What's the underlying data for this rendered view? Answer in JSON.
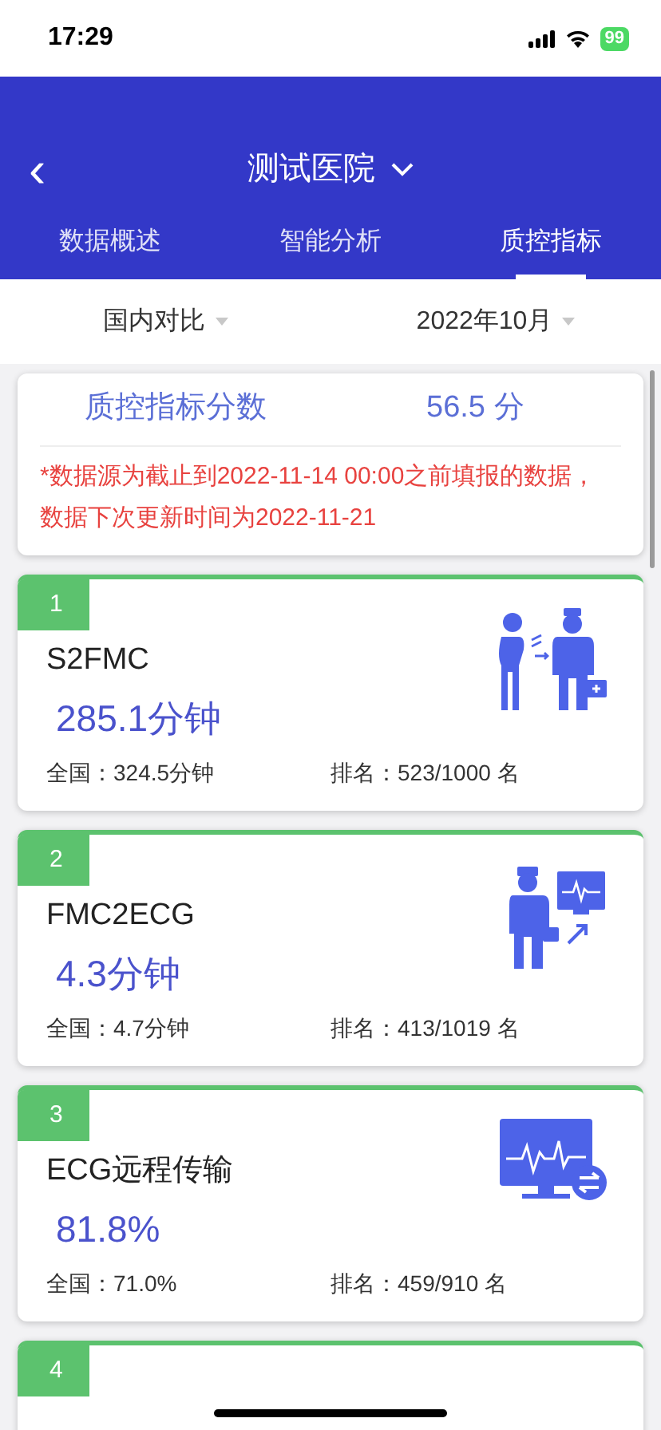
{
  "status_bar": {
    "time": "17:29",
    "battery": "99"
  },
  "header": {
    "back": "‹",
    "title": "测试医院"
  },
  "tabs": [
    {
      "label": "数据概述",
      "selected": false
    },
    {
      "label": "智能分析",
      "selected": false
    },
    {
      "label": "质控指标",
      "selected": true
    }
  ],
  "filters": [
    {
      "label": "国内对比"
    },
    {
      "label": "2022年10月"
    }
  ],
  "score_card": {
    "label": "质控指标分数",
    "value": "56.5 分",
    "note": "*数据源为截止到2022-11-14 00:00之前填报的数据，数据下次更新时间为2022-11-21"
  },
  "metrics": [
    {
      "number": "1",
      "name": "S2FMC",
      "value": "285.1分钟",
      "national": "全国：324.5分钟",
      "rank": "排名：523/1000 名",
      "kind": "patient-doctor"
    },
    {
      "number": "2",
      "name": "FMC2ECG",
      "value": "4.3分钟",
      "national": "全国：4.7分钟",
      "rank": "排名：413/1019 名",
      "kind": "doctor-monitor"
    },
    {
      "number": "3",
      "name": "ECG远程传输",
      "value": "81.8%",
      "national": "全国：71.0%",
      "rank": "排名：459/910 名",
      "kind": "monitor-transfer"
    },
    {
      "number": "4"
    }
  ]
}
